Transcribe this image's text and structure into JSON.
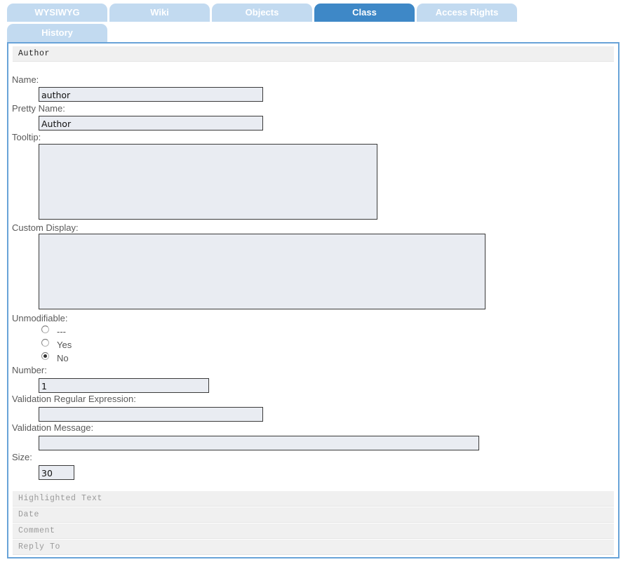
{
  "tabs": [
    {
      "label": "WYSIWYG",
      "active": false
    },
    {
      "label": "Wiki",
      "active": false
    },
    {
      "label": "Objects",
      "active": false
    },
    {
      "label": "Class",
      "active": true
    },
    {
      "label": "Access Rights",
      "active": false
    },
    {
      "label": "History",
      "active": false
    }
  ],
  "property": {
    "title": "Author",
    "fields": {
      "name": {
        "label": "Name:",
        "value": "author"
      },
      "pretty_name": {
        "label": "Pretty Name:",
        "value": "Author"
      },
      "tooltip": {
        "label": "Tooltip:",
        "value": ""
      },
      "custom_display": {
        "label": "Custom Display:",
        "value": ""
      },
      "unmodifiable": {
        "label": "Unmodifiable:",
        "options": [
          "---",
          "Yes",
          "No"
        ],
        "selected": "No"
      },
      "number": {
        "label": "Number:",
        "value": "1"
      },
      "validation_regex": {
        "label": "Validation Regular Expression:",
        "value": ""
      },
      "validation_message": {
        "label": "Validation Message:",
        "value": ""
      },
      "size": {
        "label": "Size:",
        "value": "30"
      }
    }
  },
  "other_properties": [
    "Highlighted Text",
    "Date",
    "Comment",
    "Reply To"
  ],
  "colors": {
    "tab_inactive": "#c2daf0",
    "tab_active": "#3e88c7",
    "panel_border": "#68a3d8",
    "field_background": "#e9ecf2"
  }
}
